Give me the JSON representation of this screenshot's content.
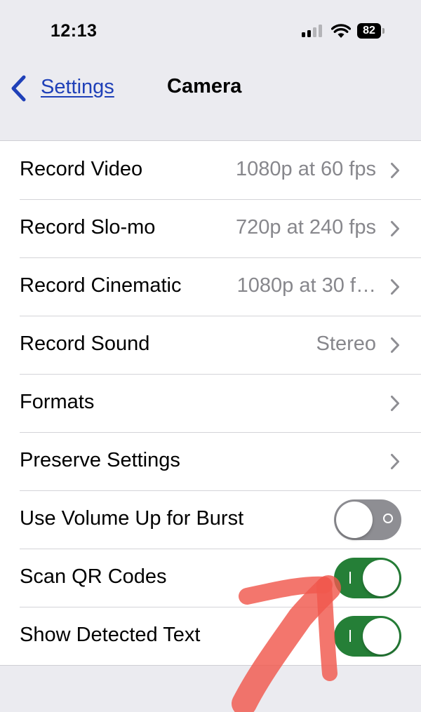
{
  "status_bar": {
    "time": "12:13",
    "battery": "82",
    "icons": [
      "cellular-signal-icon",
      "wifi-icon",
      "battery-icon"
    ]
  },
  "nav": {
    "back_label": "Settings",
    "title": "Camera",
    "back_color": "#1f40b8"
  },
  "rows": [
    {
      "label": "Record Video",
      "value": "1080p at 60 fps"
    },
    {
      "label": "Record Slo-mo",
      "value": "720p at 240 fps"
    },
    {
      "label": "Record Cinematic",
      "value": "1080p at 30 f…"
    },
    {
      "label": "Record Sound",
      "value": "Stereo"
    },
    {
      "label": "Formats",
      "value": ""
    },
    {
      "label": "Preserve Settings",
      "value": ""
    },
    {
      "label": "Use Volume Up for Burst",
      "toggle": false
    },
    {
      "label": "Scan QR Codes",
      "toggle": true
    },
    {
      "label": "Show Detected Text",
      "toggle": true
    }
  ],
  "colors": {
    "background": "#ebebf0",
    "toggle_on": "#257f37",
    "toggle_off": "#8e8e93",
    "annotation": "#f0584d"
  },
  "annotation": {
    "type": "hand-drawn red arrow pointing to Scan QR Codes toggle"
  }
}
